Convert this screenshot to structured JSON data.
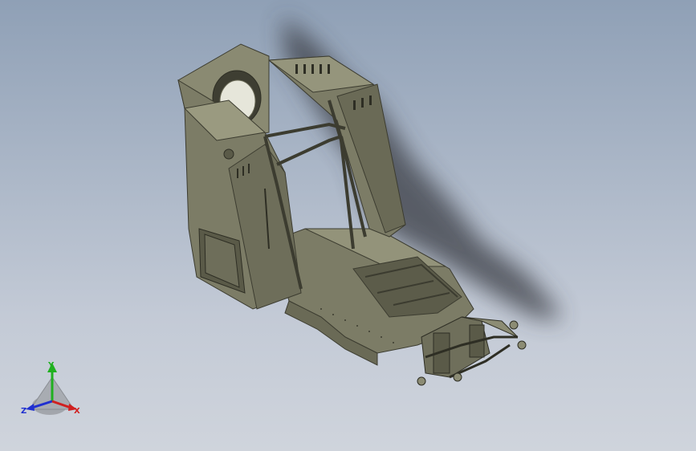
{
  "viewport": {
    "background_top": "#8fa0b6",
    "background_bottom": "#cfd4dc"
  },
  "model": {
    "body_color": "#7c7c66",
    "body_light": "#a2a288",
    "body_dark": "#4e4e40",
    "shadow_color": "#3a3c44"
  },
  "triad": {
    "y_label": "Y",
    "z_label": "Z",
    "x_label": "X",
    "y_color": "#20b020",
    "z_color": "#2030d0",
    "x_color": "#d02020"
  }
}
